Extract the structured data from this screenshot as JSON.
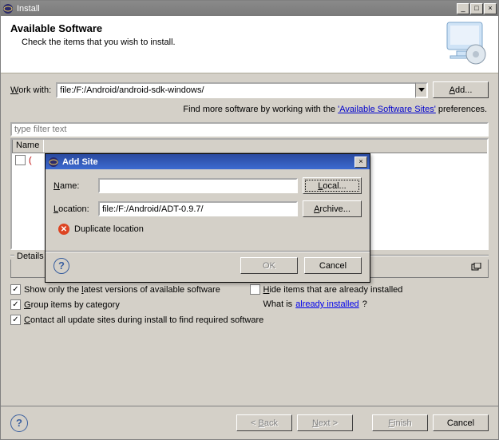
{
  "window": {
    "title": "Install",
    "banner_title": "Available Software",
    "banner_subtitle": "Check the items that you wish to install."
  },
  "workwith": {
    "label_pre": "W",
    "label_post": "ork with:",
    "value": "file:/F:/Android/android-sdk-windows/",
    "add_button": "Add...",
    "hint_pre": "Find more software by working with the ",
    "hint_link": "'Available Software Sites'",
    "hint_post": " preferences."
  },
  "filter_placeholder": "type filter text",
  "table": {
    "col_name": "Name"
  },
  "details_label": "Details",
  "options": {
    "show_latest": "Show only the latest versions of available software",
    "show_latest_u": "l",
    "hide_installed_pre": "H",
    "hide_installed_post": "ide items that are already installed",
    "group_pre": "G",
    "group_post": "roup items by category",
    "whatis_pre": "What is ",
    "whatis_link": "already installed",
    "whatis_post": "?",
    "contact_pre": "C",
    "contact_post": "ontact all update sites during install to find required software"
  },
  "footer": {
    "back": "< Back",
    "next": "Next >",
    "finish": "Finish",
    "cancel": "Cancel"
  },
  "dialog": {
    "title": "Add Site",
    "name_label_pre": "N",
    "name_label_post": "ame:",
    "name_value": "",
    "local_btn": "Local...",
    "location_label_pre": "L",
    "location_label_post": "ocation:",
    "location_value": "file:/F:/Android/ADT-0.9.7/",
    "archive_btn": "Archive...",
    "error_text": "Duplicate location",
    "ok": "OK",
    "cancel": "Cancel"
  }
}
